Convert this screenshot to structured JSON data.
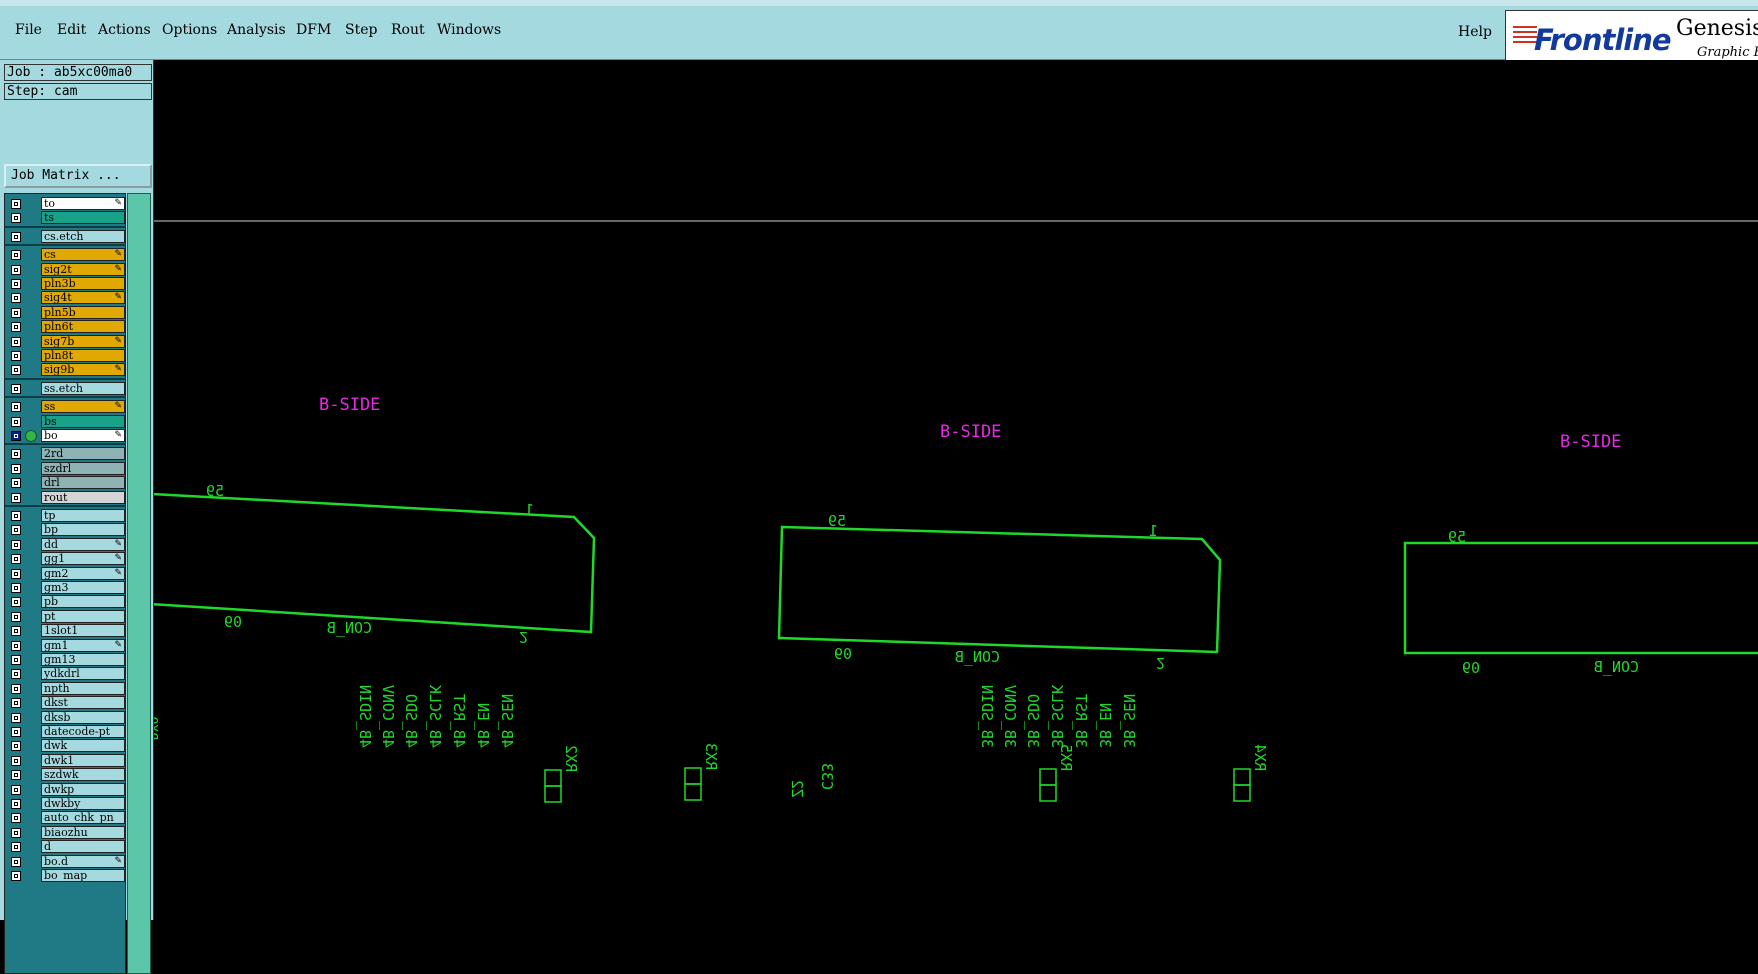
{
  "menu": {
    "items": [
      {
        "label": "File",
        "key": "file"
      },
      {
        "label": "Edit",
        "key": "edit"
      },
      {
        "label": "Actions",
        "key": "actions"
      },
      {
        "label": "Options",
        "key": "options"
      },
      {
        "label": "Analysis",
        "key": "analysis"
      },
      {
        "label": "DFM",
        "key": "dfm"
      },
      {
        "label": "Step",
        "key": "step"
      },
      {
        "label": "Rout",
        "key": "rout"
      },
      {
        "label": "Windows",
        "key": "windows"
      }
    ],
    "help_label": "Help"
  },
  "logo": {
    "brand": "Frontline",
    "product": "Genesis",
    "subtitle": "Graphic E"
  },
  "job": {
    "job_text": "Job : ab5xc00ma0",
    "step_text": "Step: cam",
    "matrix_button": "Job Matrix ..."
  },
  "colors": {
    "menu_bg": "#a3d9df",
    "layer_white": "#ffffff",
    "layer_teal": "#1aa18a",
    "layer_cyan": "#a3d9df",
    "layer_orange": "#e0a800",
    "layer_gray": "#8fb2b5",
    "layer_lightgray": "#d4d4d4",
    "canvas_bg": "#000000",
    "board_outline": "#20d82a",
    "text_magenta": "#e629e6"
  },
  "layers": [
    {
      "name": "to",
      "color": "#ffffff",
      "editable": true
    },
    {
      "name": "ts",
      "color": "#1aa18a",
      "editable": false
    },
    {
      "sep": true
    },
    {
      "name": "cs.etch",
      "color": "#a3d9df",
      "editable": false
    },
    {
      "sep": true
    },
    {
      "name": "cs",
      "color": "#e0a800",
      "editable": true
    },
    {
      "name": "sig2t",
      "color": "#e0a800",
      "editable": true
    },
    {
      "name": "pln3b",
      "color": "#e0a800",
      "editable": false
    },
    {
      "name": "sig4t",
      "color": "#e0a800",
      "editable": true
    },
    {
      "name": "pln5b",
      "color": "#e0a800",
      "editable": false
    },
    {
      "name": "pln6t",
      "color": "#e0a800",
      "editable": false
    },
    {
      "name": "sig7b",
      "color": "#e0a800",
      "editable": true
    },
    {
      "name": "pln8t",
      "color": "#e0a800",
      "editable": false
    },
    {
      "name": "sig9b",
      "color": "#e0a800",
      "editable": true
    },
    {
      "sep": true
    },
    {
      "name": "ss.etch",
      "color": "#a3d9df",
      "editable": false
    },
    {
      "sep": true
    },
    {
      "name": "ss",
      "color": "#e0a800",
      "editable": true
    },
    {
      "name": "bs",
      "color": "#1aa18a",
      "editable": false
    },
    {
      "name": "bo",
      "color": "#ffffff",
      "editable": true,
      "active": true
    },
    {
      "sep": true
    },
    {
      "name": "2rd",
      "color": "#8fb2b5",
      "editable": false
    },
    {
      "name": "szdrl",
      "color": "#8fb2b5",
      "editable": false
    },
    {
      "name": "drl",
      "color": "#8fb2b5",
      "editable": false
    },
    {
      "name": "rout",
      "color": "#d4d4d4",
      "editable": false
    },
    {
      "sep": true
    },
    {
      "name": "tp",
      "color": "#a3d9df",
      "editable": false
    },
    {
      "name": "bp",
      "color": "#a3d9df",
      "editable": false
    },
    {
      "name": "dd",
      "color": "#a3d9df",
      "editable": true
    },
    {
      "name": "gg1",
      "color": "#a3d9df",
      "editable": true
    },
    {
      "name": "gm2",
      "color": "#a3d9df",
      "editable": true
    },
    {
      "name": "gm3",
      "color": "#a3d9df",
      "editable": false
    },
    {
      "name": "pb",
      "color": "#a3d9df",
      "editable": false
    },
    {
      "name": "pt",
      "color": "#a3d9df",
      "editable": false
    },
    {
      "name": "1slot1",
      "color": "#a3d9df",
      "editable": false
    },
    {
      "name": "gm1",
      "color": "#a3d9df",
      "editable": true
    },
    {
      "name": "gm13",
      "color": "#a3d9df",
      "editable": false
    },
    {
      "name": "ydkdrl",
      "color": "#a3d9df",
      "editable": false
    },
    {
      "name": "npth",
      "color": "#a3d9df",
      "editable": false
    },
    {
      "name": "dkst",
      "color": "#a3d9df",
      "editable": false
    },
    {
      "name": "dksb",
      "color": "#a3d9df",
      "editable": false
    },
    {
      "name": "datecode-pt",
      "color": "#a3d9df",
      "editable": false
    },
    {
      "name": "dwk",
      "color": "#a3d9df",
      "editable": false
    },
    {
      "name": "dwk1",
      "color": "#a3d9df",
      "editable": false
    },
    {
      "name": "szdwk",
      "color": "#a3d9df",
      "editable": false
    },
    {
      "name": "dwkp",
      "color": "#a3d9df",
      "editable": false
    },
    {
      "name": "dwkby",
      "color": "#a3d9df",
      "editable": false
    },
    {
      "name": "auto_chk_pn",
      "color": "#a3d9df",
      "editable": false
    },
    {
      "name": "biaozhu",
      "color": "#a3d9df",
      "editable": false
    },
    {
      "name": "d",
      "color": "#a3d9df",
      "editable": false
    },
    {
      "name": "bo.d",
      "color": "#a3d9df",
      "editable": true
    },
    {
      "name": "bo_map",
      "color": "#a3d9df",
      "editable": false
    }
  ],
  "canvas": {
    "side_label": "B-SIDE",
    "connector_label": "CON_B",
    "pin_labels": [
      "59",
      "1",
      "60",
      "2"
    ],
    "bottom_left_text": "RXO",
    "rx_labels": [
      "RX2",
      "RX3",
      "RX5",
      "RX4"
    ],
    "col1_signals": [
      "4B_SDIN",
      "4B_CONV",
      "4B_SDO",
      "4B_SCLK",
      "4B_RST",
      "4B_EN",
      "4B_SEN"
    ],
    "col2_signals": [
      "3B_SDIN",
      "3B_CONV",
      "3B_SDO",
      "3B_SCLK",
      "3B_RST",
      "3B_EN",
      "3B_SEN"
    ],
    "middle_labels": [
      "Z2",
      "C33"
    ]
  }
}
